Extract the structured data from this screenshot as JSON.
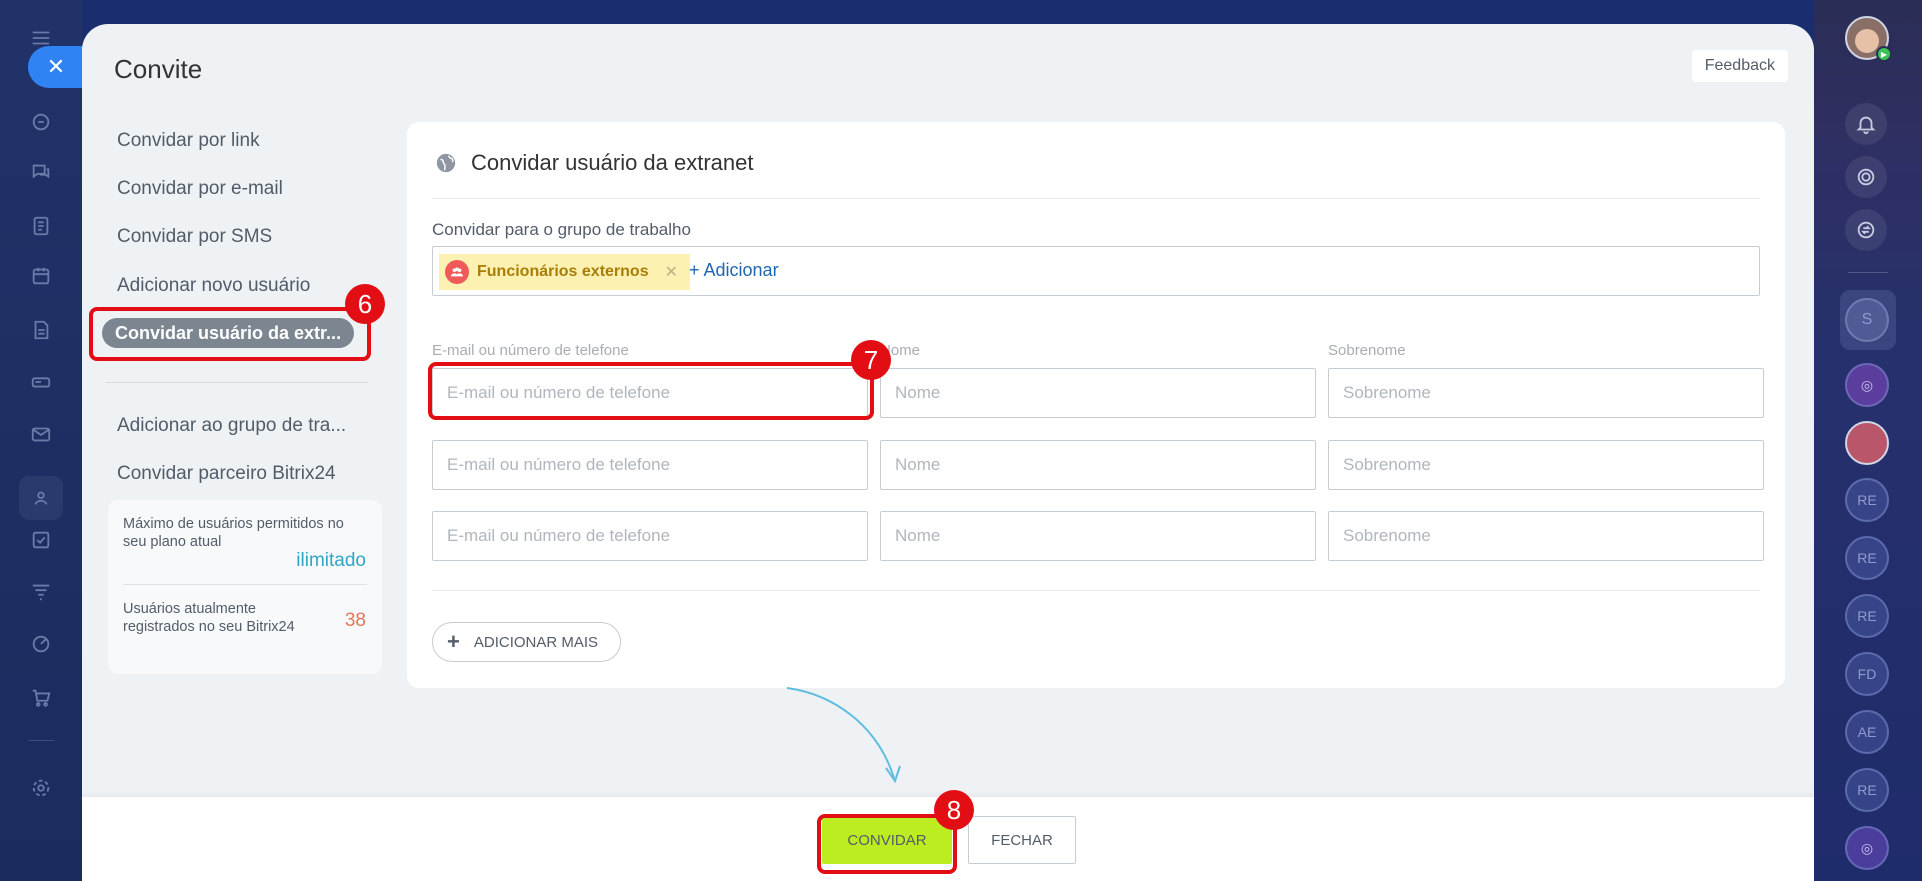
{
  "panel": {
    "title": "Convite",
    "feedback_label": "Feedback"
  },
  "menu": {
    "items": [
      {
        "label": "Convidar por link"
      },
      {
        "label": "Convidar por e-mail"
      },
      {
        "label": "Convidar por SMS"
      },
      {
        "label": "Adicionar novo usuário"
      }
    ],
    "active_label": "Convidar usuário da extr...",
    "secondary_items": [
      {
        "label": "Adicionar ao grupo de tra..."
      },
      {
        "label": "Convidar parceiro Bitrix24"
      }
    ]
  },
  "limits": {
    "max_label": "Máximo de usuários permitidos no seu plano atual",
    "max_value": "ilimitado",
    "registered_label": "Usuários atualmente registrados no seu Bitrix24",
    "registered_value": "38"
  },
  "card": {
    "title": "Convidar usuário da extranet",
    "group_label": "Convidar para o grupo de trabalho",
    "group_tag": "Funcionários externos",
    "add_link": "+ Adicionar",
    "col_email": "E-mail ou número de telefone",
    "col_name": "Nome",
    "col_surname": "Sobrenome",
    "email_placeholder": "E-mail ou número de telefone",
    "name_placeholder": "Nome",
    "surname_placeholder": "Sobrenome",
    "add_more_label": "ADICIONAR MAIS"
  },
  "footer": {
    "invite_label": "CONVIDAR",
    "close_label": "FECHAR"
  },
  "annotations": [
    "6",
    "7",
    "8"
  ],
  "right_rail": {
    "circles": [
      "S",
      "RE",
      "RE",
      "RE",
      "FD",
      "AE",
      "RE"
    ]
  },
  "colors": {
    "accent_blue": "#2f83f2",
    "invite_green": "#bbed21",
    "highlight_red": "#e30d14",
    "tag_yellow": "#fdf1b1",
    "link_blue": "#2067b0"
  }
}
